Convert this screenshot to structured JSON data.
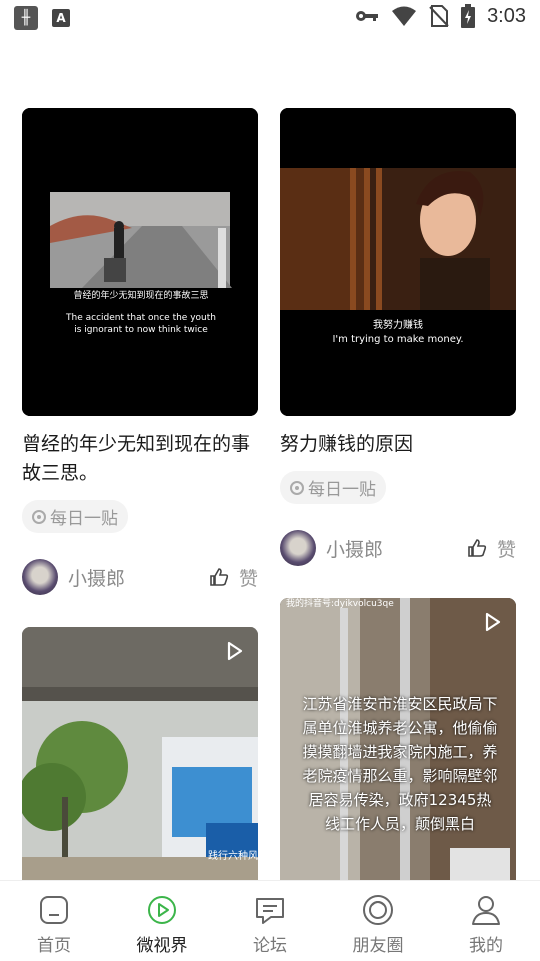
{
  "status_bar": {
    "time": "3:03",
    "left_icons": [
      "app-logo-icon",
      "a-notification-icon"
    ],
    "right_icons": [
      "key-icon",
      "wifi-icon",
      "no-sim-icon",
      "battery-charging-icon"
    ]
  },
  "feed": {
    "cards": [
      {
        "title": "曾经的年少无知到现在的事故三思。",
        "tag": "每日一贴",
        "author": "小摄郎",
        "like_label": "赞",
        "subtitle_cn": "曾经的年少无知到现在的事故三思",
        "subtitle_en": "The accident that once the youth is ignorant to now think twice"
      },
      {
        "title": "努力赚钱的原因",
        "tag": "每日一贴",
        "author": "小摄郎",
        "like_label": "赞",
        "subtitle_cn": "我努力赚钱",
        "subtitle_en": "I'm trying to make money."
      },
      {
        "sign_text": "践行六种风"
      },
      {
        "top_text": "我的抖音号:dyikvolcu3qe",
        "overlay_text": "江苏省淮安市淮安区民政局下属单位淮城养老公寓，他偷偷摸摸翻墙进我家院内施工，养老院疫情那么重，影响隔壁邻居容易传染，政府12345热线工作人员，颠倒黑白"
      }
    ]
  },
  "bottom_nav": {
    "items": [
      {
        "label": "首页",
        "icon": "home-icon"
      },
      {
        "label": "微视界",
        "icon": "play-circle-icon",
        "active": true
      },
      {
        "label": "论坛",
        "icon": "forum-chat-icon"
      },
      {
        "label": "朋友圈",
        "icon": "moments-icon"
      },
      {
        "label": "我的",
        "icon": "profile-icon"
      }
    ],
    "active_color": "#3cb54a",
    "inactive_color": "#777777"
  }
}
